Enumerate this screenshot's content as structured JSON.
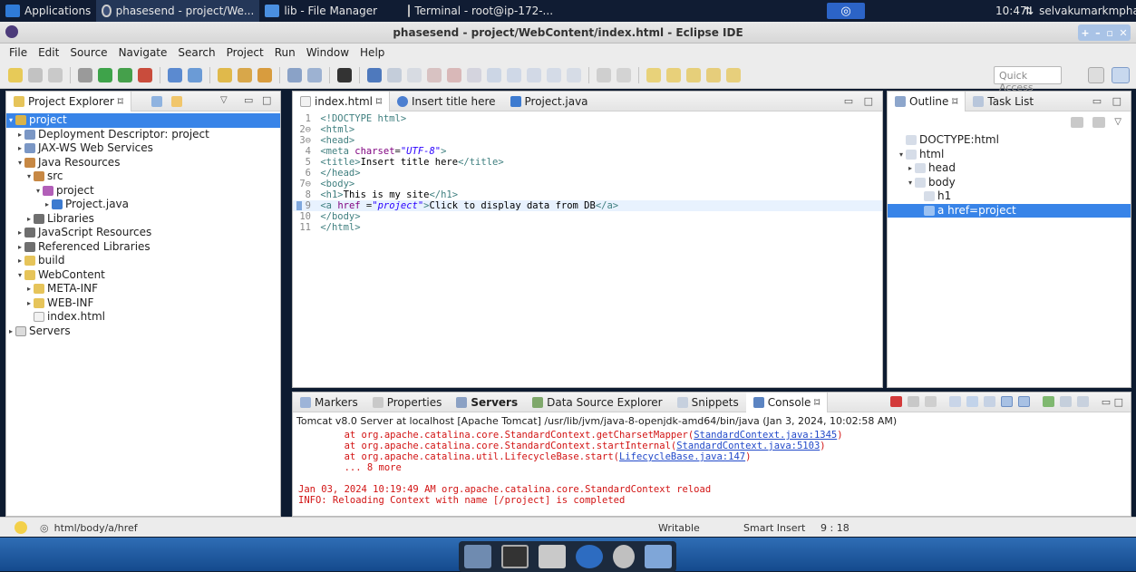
{
  "taskbar": {
    "applications": "Applications",
    "eclipse_task": "phasesend - project/We...",
    "files_task": "lib - File Manager",
    "terminal_task": "Terminal - root@ip-172-...",
    "clock": "10:47",
    "user": "selvakumarkmpha"
  },
  "window": {
    "title": "phasesend - project/WebContent/index.html - Eclipse IDE"
  },
  "menu": [
    "File",
    "Edit",
    "Source",
    "Navigate",
    "Search",
    "Project",
    "Run",
    "Window",
    "Help"
  ],
  "toolbar": {
    "quick_access_placeholder": "Quick Access"
  },
  "project_explorer": {
    "tab_label": "Project Explorer ⌑",
    "tree": [
      {
        "label": "project",
        "depth": 0,
        "arrow": "▾",
        "icon": "proj",
        "selected": true
      },
      {
        "label": "Deployment Descriptor: project",
        "depth": 1,
        "arrow": "▸",
        "icon": "web"
      },
      {
        "label": "JAX-WS Web Services",
        "depth": 1,
        "arrow": "▸",
        "icon": "web"
      },
      {
        "label": "Java Resources",
        "depth": 1,
        "arrow": "▾",
        "icon": "jar"
      },
      {
        "label": "src",
        "depth": 2,
        "arrow": "▾",
        "icon": "jar"
      },
      {
        "label": "project",
        "depth": 3,
        "arrow": "▾",
        "icon": "pkg"
      },
      {
        "label": "Project.java",
        "depth": 4,
        "arrow": "▸",
        "icon": "java"
      },
      {
        "label": "Libraries",
        "depth": 2,
        "arrow": "▸",
        "icon": "lib"
      },
      {
        "label": "JavaScript Resources",
        "depth": 1,
        "arrow": "▸",
        "icon": "lib"
      },
      {
        "label": "Referenced Libraries",
        "depth": 1,
        "arrow": "▸",
        "icon": "lib"
      },
      {
        "label": "build",
        "depth": 1,
        "arrow": "▸",
        "icon": "folder"
      },
      {
        "label": "WebContent",
        "depth": 1,
        "arrow": "▾",
        "icon": "folder"
      },
      {
        "label": "META-INF",
        "depth": 2,
        "arrow": "▸",
        "icon": "folder"
      },
      {
        "label": "WEB-INF",
        "depth": 2,
        "arrow": "▸",
        "icon": "folder"
      },
      {
        "label": "index.html",
        "depth": 2,
        "arrow": "",
        "icon": "file"
      },
      {
        "label": "Servers",
        "depth": 0,
        "arrow": "▸",
        "icon": "server"
      }
    ]
  },
  "editor": {
    "tabs": [
      "index.html ⌑",
      "Insert title here",
      "Project.java"
    ],
    "lines": [
      {
        "n": "1",
        "html": "<span class=\"tag\">&lt;!DOCTYPE html&gt;</span>"
      },
      {
        "n": "2⊖",
        "html": "<span class=\"tag\">&lt;html&gt;</span>"
      },
      {
        "n": "3⊖",
        "html": "<span class=\"tag\">&lt;head&gt;</span>"
      },
      {
        "n": "4",
        "html": "<span class=\"tag\">&lt;meta</span> <span class=\"attr\">charset</span>=<span class=\"str\">\"UTF-8\"</span><span class=\"tag\">&gt;</span>"
      },
      {
        "n": "5",
        "html": "<span class=\"tag\">&lt;title&gt;</span><span class=\"txt\">Insert title here</span><span class=\"tag\">&lt;/title&gt;</span>"
      },
      {
        "n": "6",
        "html": "<span class=\"tag\">&lt;/head&gt;</span>"
      },
      {
        "n": "7⊖",
        "html": "<span class=\"tag\">&lt;body&gt;</span>"
      },
      {
        "n": "8",
        "html": "<span class=\"tag\">&lt;h1&gt;</span><span class=\"txt\">This is my site</span><span class=\"tag\">&lt;/h1&gt;</span>"
      },
      {
        "n": "9",
        "html": "<span class=\"tag\">&lt;a</span> <span class=\"attr\">href</span> =<span class=\"str\">\"project\"</span><span class=\"tag\">&gt;</span><span class=\"txt\">Click to display data from DB</span><span class=\"tag\">&lt;/a&gt;</span>",
        "current": true
      },
      {
        "n": "10",
        "html": "<span class=\"tag\">&lt;/body&gt;</span>"
      },
      {
        "n": "11",
        "html": "<span class=\"tag\">&lt;/html&gt;</span>"
      }
    ]
  },
  "outline": {
    "tabs": [
      "Outline ⌑",
      "Task List"
    ],
    "tree": [
      {
        "label": "DOCTYPE:html",
        "depth": 0,
        "arrow": ""
      },
      {
        "label": "html",
        "depth": 0,
        "arrow": "▾"
      },
      {
        "label": "head",
        "depth": 1,
        "arrow": "▸"
      },
      {
        "label": "body",
        "depth": 1,
        "arrow": "▾"
      },
      {
        "label": "h1",
        "depth": 2,
        "arrow": ""
      },
      {
        "label": "a href=project",
        "depth": 2,
        "arrow": "",
        "selected": true
      }
    ]
  },
  "console": {
    "tabs": [
      "Markers",
      "Properties",
      "Servers",
      "Data Source Explorer",
      "Snippets",
      "Console ⌑"
    ],
    "description": "Tomcat v8.0 Server at localhost [Apache Tomcat] /usr/lib/jvm/java-8-openjdk-amd64/bin/java (Jan 3, 2024, 10:02:58 AM)",
    "lines": [
      {
        "text": "        at org.apache.catalina.core.StandardContext.getCharsetMapper(",
        "link": "StandardContext.java:1345",
        "tail": ")"
      },
      {
        "text": "        at org.apache.catalina.core.StandardContext.startInternal(",
        "link": "StandardContext.java:5103",
        "tail": ")"
      },
      {
        "text": "        at org.apache.catalina.util.LifecycleBase.start(",
        "link": "LifecycleBase.java:147",
        "tail": ")"
      },
      {
        "text": "        ... 8 more",
        "link": "",
        "tail": ""
      },
      {
        "text": "",
        "link": "",
        "tail": ""
      },
      {
        "text": "Jan 03, 2024 10:19:49 AM org.apache.catalina.core.StandardContext reload",
        "link": "",
        "tail": ""
      },
      {
        "text": "INFO: Reloading Context with name [/project] is completed",
        "link": "",
        "tail": ""
      }
    ]
  },
  "status": {
    "path": "html/body/a/href",
    "writable": "Writable",
    "insert_mode": "Smart Insert",
    "position": "9 : 18"
  },
  "colors": {
    "selection": "#3884e8",
    "taskbar": "#101c33",
    "dock": "#1c4f92"
  }
}
